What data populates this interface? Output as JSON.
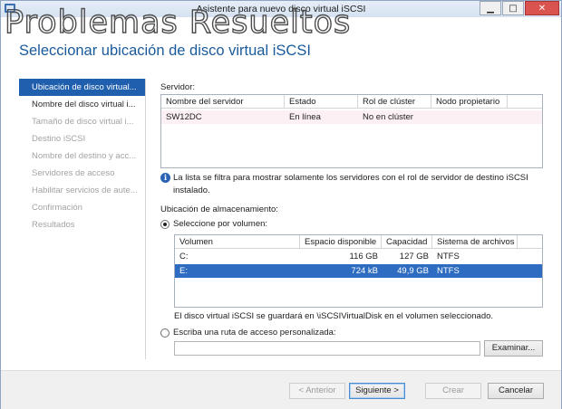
{
  "window": {
    "title": "Asistente para nuevo disco virtual iSCSI",
    "minimize_icon": "minimize-icon",
    "maximize_icon": "maximize-icon",
    "close_icon": "close-icon"
  },
  "watermark": "Problemas Resueltos",
  "page_title": "Seleccionar ubicación de disco virtual iSCSI",
  "nav": {
    "items": [
      {
        "label": "Ubicación de disco virtual...",
        "state": "active"
      },
      {
        "label": "Nombre del disco virtual i...",
        "state": "enabled"
      },
      {
        "label": "Tamaño de disco virtual i...",
        "state": "disabled"
      },
      {
        "label": "Destino iSCSI",
        "state": "disabled"
      },
      {
        "label": "Nombre del destino y acc...",
        "state": "disabled"
      },
      {
        "label": "Servidores de acceso",
        "state": "disabled"
      },
      {
        "label": "Habilitar servicios de aute...",
        "state": "disabled"
      },
      {
        "label": "Confirmación",
        "state": "disabled"
      },
      {
        "label": "Resultados",
        "state": "disabled"
      }
    ]
  },
  "server_section": {
    "label": "Servidor:",
    "columns": [
      "Nombre del servidor",
      "Estado",
      "Rol de clúster",
      "Nodo propietario"
    ],
    "rows": [
      [
        "SW12DC",
        "En línea",
        "No en clúster",
        ""
      ]
    ],
    "info_text_line1": "La lista se filtra para mostrar solamente los servidores con el rol de servidor de destino iSCSI",
    "info_text_line2": "instalado."
  },
  "storage_section": {
    "label": "Ubicación de almacenamiento:",
    "by_volume_label": "Seleccione por volumen:",
    "by_volume_selected": true,
    "columns": [
      "Volumen",
      "Espacio disponible",
      "Capacidad",
      "Sistema de archivos"
    ],
    "rows": [
      {
        "cells": [
          "C:",
          "116 GB",
          "127 GB",
          "NTFS"
        ],
        "selected": false
      },
      {
        "cells": [
          "E:",
          "724 kB",
          "49,9 GB",
          "NTFS"
        ],
        "selected": true
      }
    ],
    "save_note": "El disco virtual iSCSI se guardará en \\iSCSIVirtualDisk en el volumen seleccionado.",
    "custom_path_label": "Escriba una ruta de acceso personalizada:",
    "custom_path_value": "",
    "browse_label": "Examinar..."
  },
  "footer": {
    "previous_label": "< Anterior",
    "next_label": "Siguiente >",
    "create_label": "Crear",
    "cancel_label": "Cancelar"
  },
  "colors": {
    "accent": "#1f5fae",
    "title_blue": "#1a5a9b"
  }
}
